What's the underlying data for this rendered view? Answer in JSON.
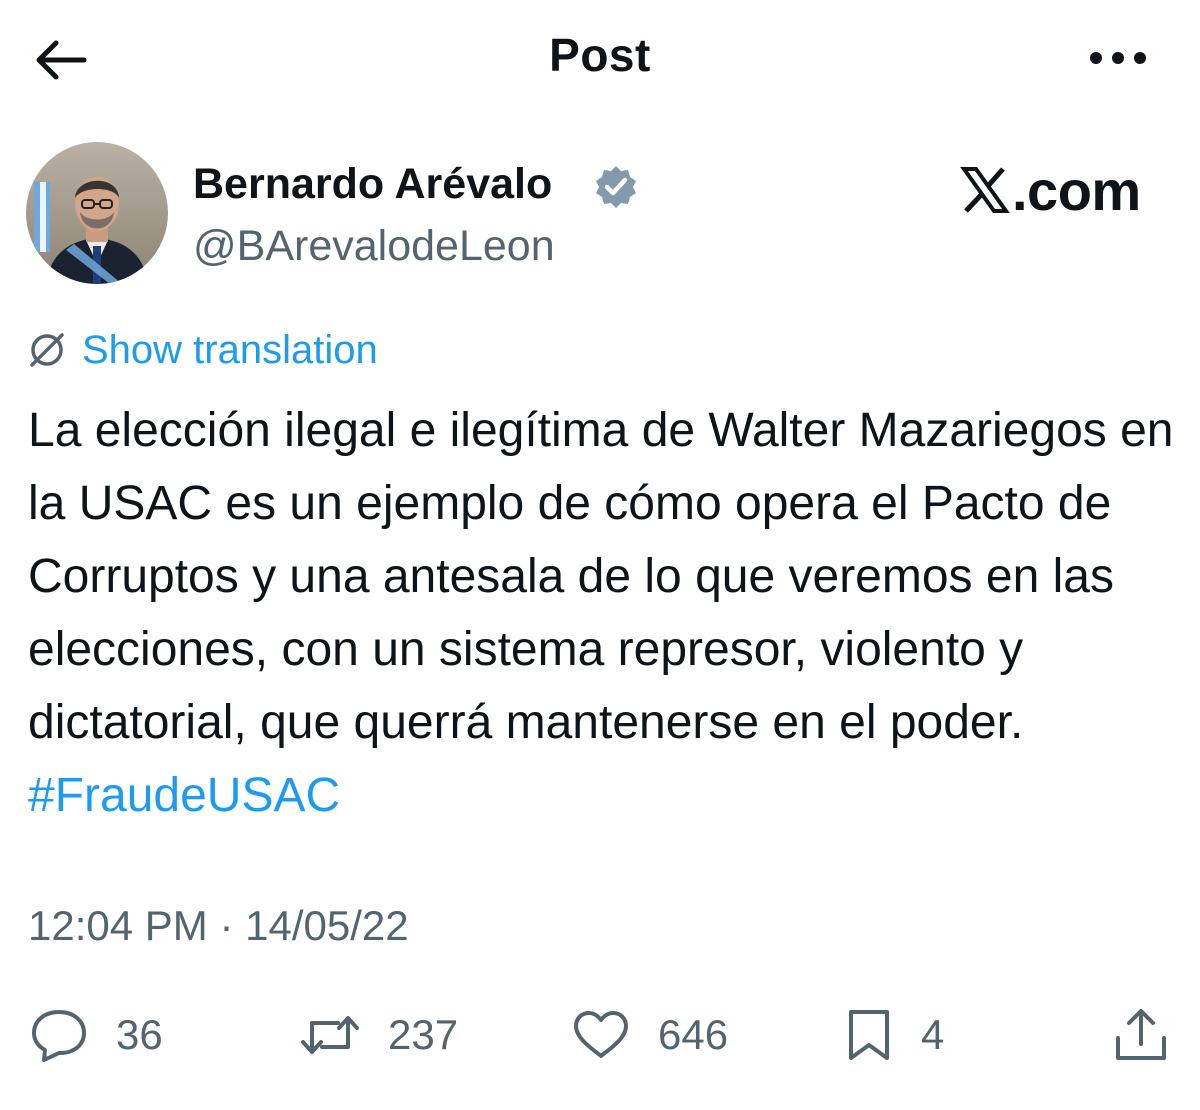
{
  "header": {
    "title": "Post",
    "back_icon": "arrow-left-icon",
    "more_icon": "more-horizontal-icon"
  },
  "author": {
    "name": "Bernardo Arévalo",
    "handle": "@BArevalodeLeon",
    "verified": true,
    "verified_color": "#829aab"
  },
  "watermark": {
    "text": ".com",
    "logo": "x-logo-icon"
  },
  "translation": {
    "label": "Show translation",
    "icon": "globe-icon"
  },
  "tweet": {
    "text": "La elección ilegal e ilegítima de Walter Mazariegos en la USAC es un ejemplo de cómo opera el Pacto de Corruptos y una antesala de lo que veremos en las elecciones, con un sistema represor, violento y dictatorial, que querrá mantenerse en el poder.",
    "hashtag": "#FraudeUSAC",
    "time": "12:04 PM · 14/05/22"
  },
  "actions": {
    "replies": "36",
    "reposts": "237",
    "likes": "646",
    "bookmarks": "4",
    "share_icon": "share-icon"
  },
  "colors": {
    "accent": "#1d9bf0",
    "text": "#0f1419",
    "secondary": "#536471"
  }
}
